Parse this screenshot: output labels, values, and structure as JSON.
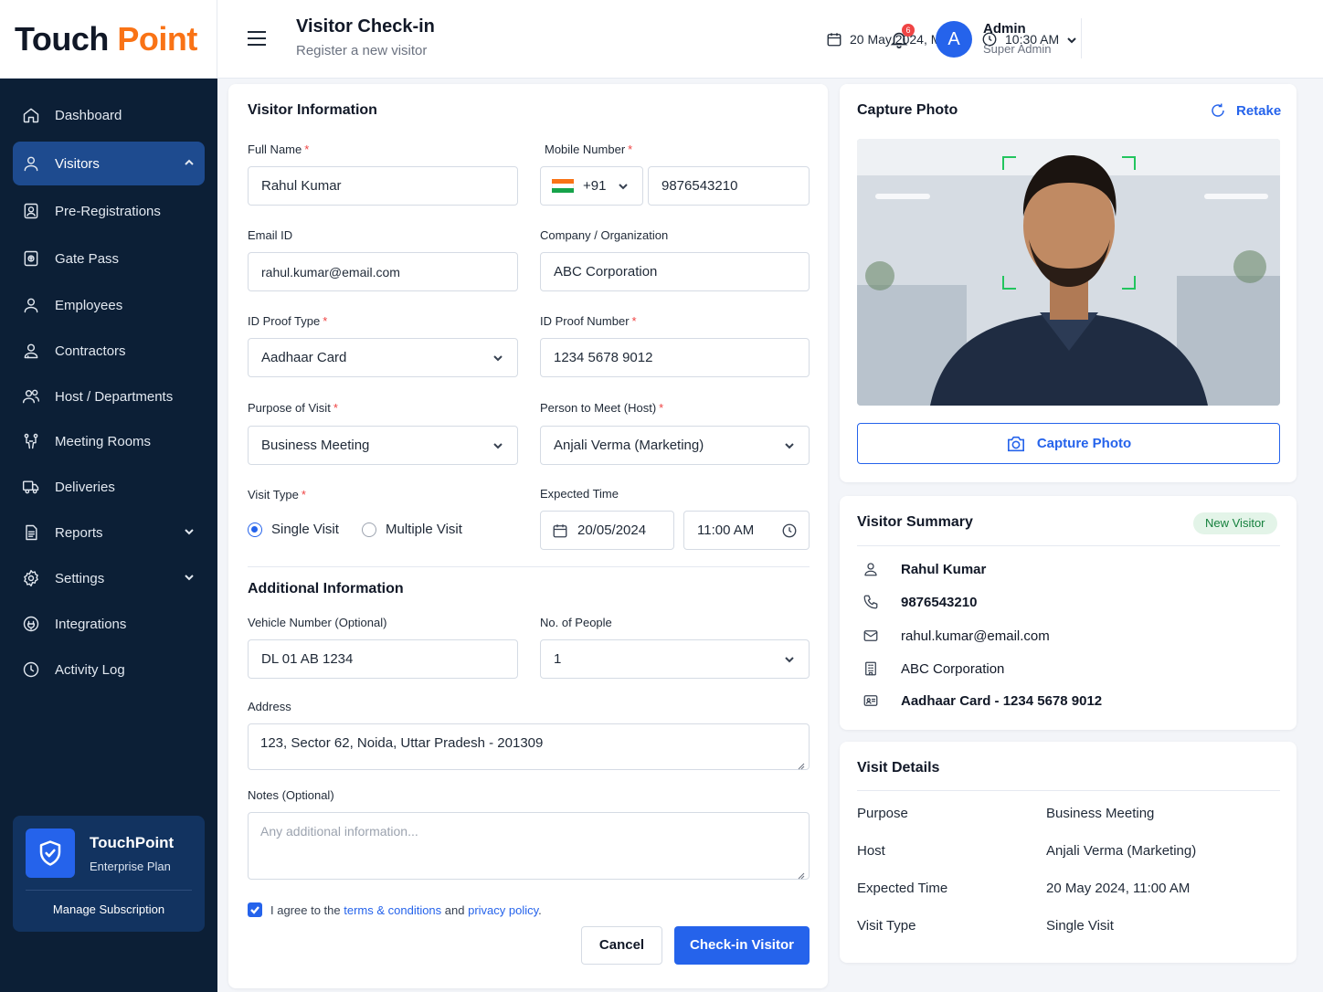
{
  "brand": {
    "logo_touch": "T",
    "logo_o": "o",
    "logo_uch": "uch",
    "logo_point": "Point"
  },
  "header": {
    "title": "Visitor Check-in",
    "subtitle": "Register a new visitor",
    "date": "20 May 2024, Mon",
    "time": "10:30 AM",
    "notifications": "6",
    "avatar_letter": "A",
    "user_name": "Admin",
    "user_role": "Super Admin"
  },
  "sidebar": {
    "items": [
      {
        "label": "Dashboard",
        "icon": "home-icon"
      },
      {
        "label": "Visitors",
        "icon": "user-icon",
        "active": true
      },
      {
        "label": "Pre-Registrations",
        "icon": "clipboard-user-icon"
      },
      {
        "label": "Gate Pass",
        "icon": "pass-icon"
      },
      {
        "label": "Employees",
        "icon": "user-icon"
      },
      {
        "label": "Contractors",
        "icon": "contractor-icon"
      },
      {
        "label": "Host / Departments",
        "icon": "users-icon"
      },
      {
        "label": "Meeting Rooms",
        "icon": "meeting-icon"
      },
      {
        "label": "Deliveries",
        "icon": "truck-icon"
      },
      {
        "label": "Reports",
        "icon": "report-icon"
      },
      {
        "label": "Settings",
        "icon": "gear-icon"
      },
      {
        "label": "Integrations",
        "icon": "plug-icon"
      },
      {
        "label": "Activity Log",
        "icon": "clock-icon"
      }
    ],
    "plan": {
      "name": "TouchPoint",
      "tier": "Enterprise Plan",
      "manage": "Manage Subscription"
    }
  },
  "form": {
    "title": "Visitor Information",
    "full_name": {
      "label": "Full Name",
      "value": "Rahul Kumar"
    },
    "mobile": {
      "label": "Mobile Number",
      "code": "+91",
      "value": "9876543210"
    },
    "email": {
      "label": "Email ID",
      "value": "rahul.kumar@email.com"
    },
    "company": {
      "label": "Company / Organization",
      "value": "ABC Corporation"
    },
    "id_type": {
      "label": "ID Proof Type",
      "value": "Aadhaar Card"
    },
    "id_number": {
      "label": "ID Proof Number",
      "value": "1234 5678 9012"
    },
    "purpose": {
      "label": "Purpose of Visit",
      "value": "Business Meeting"
    },
    "host": {
      "label": "Person to Meet (Host)",
      "value": "Anjali Verma (Marketing)"
    },
    "visit_type": {
      "label": "Visit Type",
      "single": "Single Visit",
      "multiple": "Multiple Visit"
    },
    "expected": {
      "label": "Expected Time",
      "date": "20/05/2024",
      "time": "11:00 AM"
    },
    "additional_title": "Additional Information",
    "vehicle": {
      "label": "Vehicle Number (Optional)",
      "value": "DL 01 AB 1234"
    },
    "people": {
      "label": "No. of People",
      "value": "1"
    },
    "address": {
      "label": "Address",
      "value": "123, Sector 62, Noida, Uttar Pradesh - 201309"
    },
    "notes": {
      "label": "Notes (Optional)",
      "placeholder": "Any additional information..."
    },
    "agree": {
      "prefix": "I agree to the ",
      "terms": "terms & conditions",
      "mid": " and ",
      "privacy": "privacy policy",
      "suffix": "."
    },
    "cancel": "Cancel",
    "submit": "Check-in Visitor"
  },
  "photo": {
    "title": "Capture Photo",
    "retake": "Retake",
    "capture": "Capture Photo"
  },
  "summary": {
    "title": "Visitor Summary",
    "badge": "New Visitor",
    "name": "Rahul Kumar",
    "phone": "9876543210",
    "email": "rahul.kumar@email.com",
    "company": "ABC Corporation",
    "id": "Aadhaar Card - 1234 5678 9012"
  },
  "details": {
    "title": "Visit Details",
    "rows": [
      {
        "k": "Purpose",
        "v": "Business Meeting"
      },
      {
        "k": "Host",
        "v": "Anjali Verma (Marketing)"
      },
      {
        "k": "Expected Time",
        "v": "20 May 2024, 11:00 AM"
      },
      {
        "k": "Visit Type",
        "v": "Single Visit"
      }
    ]
  },
  "colors": {
    "accent": "#2563eb",
    "sidebar": "#0c1f36",
    "brand_orange": "#f97316",
    "success": "#15803d"
  }
}
